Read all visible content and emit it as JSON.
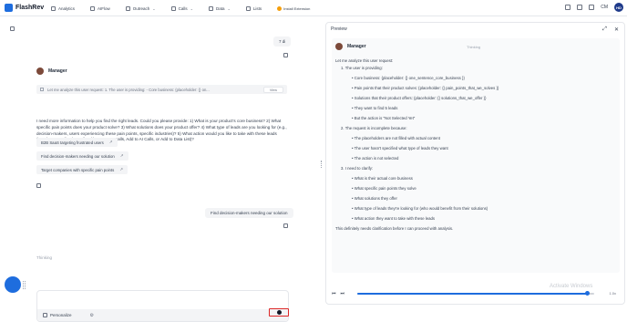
{
  "brand": {
    "name": "FlashRev"
  },
  "nav": [
    {
      "label": "Analytics",
      "has_caret": false
    },
    {
      "label": "AIFlow",
      "has_caret": false
    },
    {
      "label": "Outreach",
      "has_caret": true
    },
    {
      "label": "Calls",
      "has_caret": true
    },
    {
      "label": "Data",
      "has_caret": true
    },
    {
      "label": "Lists",
      "has_caret": false
    }
  ],
  "install_extension": "Install Extension",
  "topright": {
    "cm_label": "CM",
    "avatar_initials": "HD"
  },
  "chat": {
    "user_messages": [
      "7 di",
      "Find decision-makers needing our solution"
    ],
    "manager_name": "Manager",
    "analyze_bar": "Let me analyze this user request: 1. The user is providing: - Core business: {placeholder: {} on...",
    "analyze_button": "View",
    "assistant_message": "I need more information to help you find the right leads. Could you please provide: 1) What is your product's core business? 2) What specific pain points does your product solve? 3) What solutions does your product offer? 4) What type of leads are you looking for (e.g., decision-makers, users experiencing these pain points, specific industries)? 5) What action would you like to take with these leads (Send Personalized Email, Add to Human Calls, Add to AI Calls, or Add to Data List)?",
    "suggestions": [
      "B2B SaaS targeting frustrated users",
      "Find decision-makers needing our solution",
      "Target companies with specific pain points"
    ],
    "thinking_text": "Thinking",
    "composer": {
      "personalize_label": "Personalize"
    }
  },
  "preview": {
    "title": "Preview",
    "manager_name": "Manager",
    "status": "Thinking",
    "lines": [
      {
        "text": "Let me analyze this user request:",
        "indent": 0
      },
      {
        "text": "1. The user is providing:",
        "indent": 1
      },
      {
        "text": "Core business: {placeholder: {} one_sentence_core_business }}",
        "indent": 2
      },
      {
        "text": "Pain points that their product solves: {placeholder: {} pain_points_that_we_solves }}",
        "indent": 2
      },
      {
        "text": "Solutions that their product offers: {placeholder: {} solutions_that_we_offer }}",
        "indent": 2
      },
      {
        "text": "They want to find 5 leads",
        "indent": 2
      },
      {
        "text": "But the action is \"Not Selected Yet\"",
        "indent": 2
      },
      {
        "text": "2. The request is incomplete because:",
        "indent": 1
      },
      {
        "text": "The placeholders are not filled with actual content",
        "indent": 2
      },
      {
        "text": "The user hasn't specified what type of leads they want",
        "indent": 2
      },
      {
        "text": "The action is not selected",
        "indent": 2
      },
      {
        "text": "3. I need to clarify:",
        "indent": 1
      },
      {
        "text": "What is their actual core business",
        "indent": 2
      },
      {
        "text": "What specific pain points they solve",
        "indent": 2
      },
      {
        "text": "What solutions they offer",
        "indent": 2
      },
      {
        "text": "What type of leads they're looking for (who would benefit from their solutions)",
        "indent": 2
      },
      {
        "text": "What action they want to take with these leads",
        "indent": 2
      },
      {
        "text": "This definitely needs clarification before I can proceed with analysis.",
        "indent": 0
      }
    ],
    "player": {
      "progress": 0.97,
      "speed": "1.0x"
    },
    "watermark": "Activate Windows"
  }
}
